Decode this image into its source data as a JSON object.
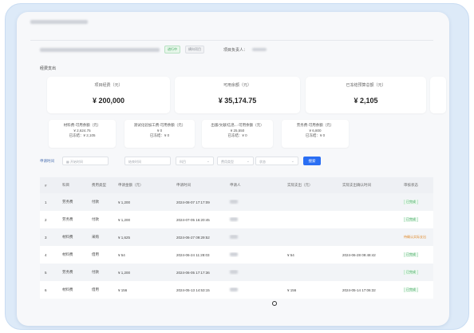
{
  "project": {
    "status_tag": "进行中",
    "type_tag": "横向项目",
    "leader_label": "项目负责人："
  },
  "section_title": "经费支出",
  "summary_cards": [
    {
      "label": "项目经费（元）",
      "value": "¥ 200,000"
    },
    {
      "label": "可用余额（元）",
      "value": "¥ 35,174.75"
    },
    {
      "label": "已冻结预算总额（元）",
      "value": "¥ 2,105"
    }
  ],
  "category_cards": [
    {
      "title": "材料费-可用余额（元）",
      "available": "¥ 2,624.75",
      "frozen": "已冻结：¥ 2,105"
    },
    {
      "title": "测试化验加工费-可用余额（元）",
      "available": "¥ 0",
      "frozen": "已冻结：¥ 0"
    },
    {
      "title": "出版/文献/信息...-可用余额（元）",
      "available": "¥ 25,550",
      "frozen": "已冻结：¥ 0"
    },
    {
      "title": "劳务费-可用余额（元）",
      "available": "¥ 6,800",
      "frozen": "已冻结：¥ 0"
    }
  ],
  "filters": {
    "label": "申请时间",
    "start_placeholder": "开始时间",
    "end_placeholder": "结束时间",
    "category_placeholder": "科目",
    "type_placeholder": "费用类型",
    "status_placeholder": "状态",
    "search_label": "搜索"
  },
  "table": {
    "headers": [
      "#",
      "科目",
      "费用类型",
      "申请金额（元）",
      "申请时间",
      "申请人",
      "实际支出（元）",
      "实际支出确认时间",
      "审核状态"
    ],
    "rows": [
      {
        "no": "1",
        "subject": "劳务费",
        "type": "付款",
        "amount": "¥ 1,200",
        "time": "2024-08-07 17:17:09",
        "actual": "",
        "confirm": "",
        "status": "已完成",
        "status_kind": "ok"
      },
      {
        "no": "2",
        "subject": "劳务费",
        "type": "付款",
        "amount": "¥ 1,200",
        "time": "2024-07-05 16:20:45",
        "actual": "",
        "confirm": "",
        "status": "已完成",
        "status_kind": "ok"
      },
      {
        "no": "3",
        "subject": "材料费",
        "type": "采购",
        "amount": "¥ 1,625",
        "time": "2024-06-27 09:29:52",
        "actual": "",
        "confirm": "",
        "status": "待确认实际支出",
        "status_kind": "warn"
      },
      {
        "no": "4",
        "subject": "材料费",
        "type": "借用",
        "amount": "¥ 54",
        "time": "2024-06-24 11:28:03",
        "actual": "¥ 54",
        "confirm": "2024-06-28 09:48:42",
        "status": "已完成",
        "status_kind": "ok"
      },
      {
        "no": "5",
        "subject": "劳务费",
        "type": "付款",
        "amount": "¥ 1,200",
        "time": "2024-06-05 17:17:36",
        "actual": "",
        "confirm": "",
        "status": "已完成",
        "status_kind": "ok"
      },
      {
        "no": "6",
        "subject": "材料费",
        "type": "借用",
        "amount": "¥ 156",
        "time": "2024-05-13 14:53:15",
        "actual": "¥ 156",
        "confirm": "2024-05-14 17:06:32",
        "status": "已完成",
        "status_kind": "ok"
      }
    ]
  }
}
